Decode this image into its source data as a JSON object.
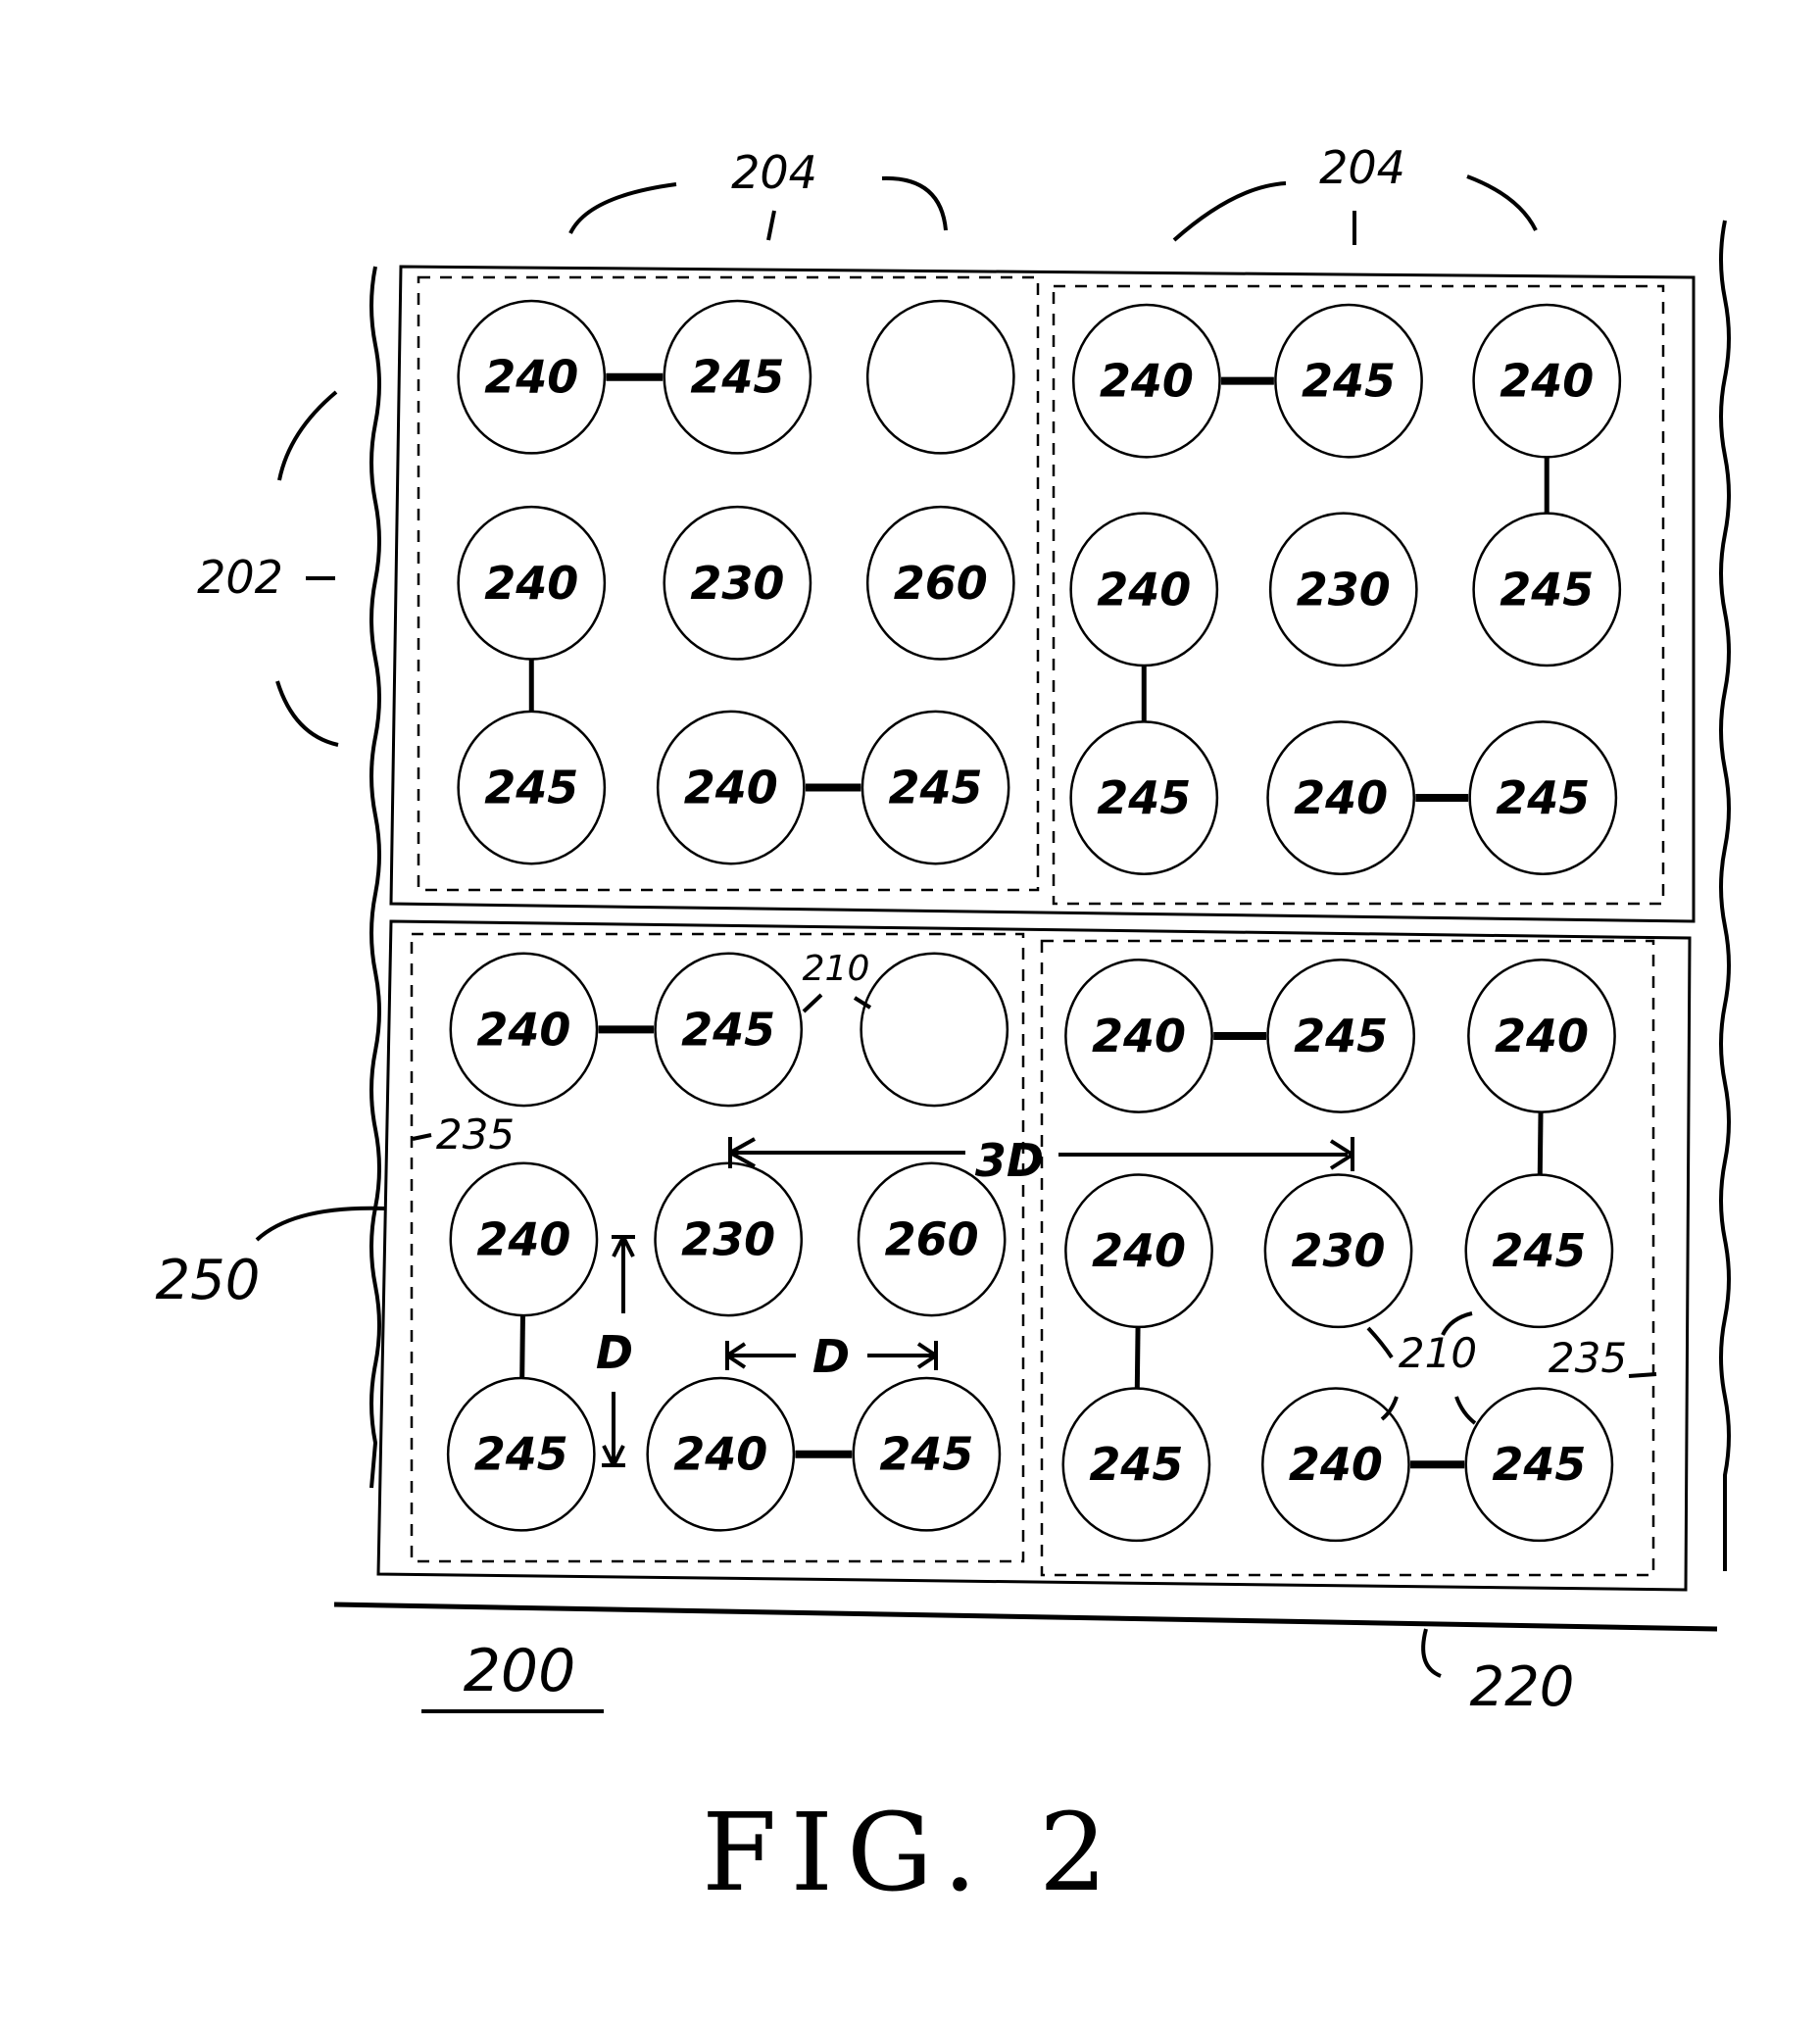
{
  "figure": {
    "title": "FIG. 2",
    "reference_numeral": "200",
    "cells": [
      {
        "block": "top-left",
        "grid": [
          [
            "240",
            "245",
            ""
          ],
          [
            "240",
            "230",
            "260"
          ],
          [
            "245",
            "240",
            "245"
          ]
        ],
        "links": [
          [
            [
              0,
              0
            ],
            [
              0,
              1
            ]
          ],
          [
            [
              1,
              0
            ],
            [
              2,
              0
            ]
          ],
          [
            [
              2,
              1
            ],
            [
              2,
              2
            ]
          ]
        ]
      },
      {
        "block": "top-right",
        "grid": [
          [
            "240",
            "245",
            "240"
          ],
          [
            "240",
            "230",
            "245"
          ],
          [
            "245",
            "240",
            "245"
          ]
        ],
        "links": [
          [
            [
              0,
              0
            ],
            [
              0,
              1
            ]
          ],
          [
            [
              0,
              2
            ],
            [
              1,
              2
            ]
          ],
          [
            [
              1,
              0
            ],
            [
              2,
              0
            ]
          ],
          [
            [
              2,
              1
            ],
            [
              2,
              2
            ]
          ]
        ]
      },
      {
        "block": "bottom-left",
        "grid": [
          [
            "240",
            "245",
            ""
          ],
          [
            "240",
            "230",
            "260"
          ],
          [
            "245",
            "240",
            "245"
          ]
        ],
        "links": [
          [
            [
              0,
              0
            ],
            [
              0,
              1
            ]
          ],
          [
            [
              1,
              0
            ],
            [
              2,
              0
            ]
          ],
          [
            [
              2,
              1
            ],
            [
              2,
              2
            ]
          ]
        ]
      },
      {
        "block": "bottom-right",
        "grid": [
          [
            "240",
            "245",
            "240"
          ],
          [
            "240",
            "230",
            "245"
          ],
          [
            "245",
            "240",
            "245"
          ]
        ],
        "links": [
          [
            [
              0,
              0
            ],
            [
              0,
              1
            ]
          ],
          [
            [
              0,
              2
            ],
            [
              1,
              2
            ]
          ],
          [
            [
              1,
              0
            ],
            [
              2,
              0
            ]
          ],
          [
            [
              2,
              1
            ],
            [
              2,
              2
            ]
          ]
        ]
      }
    ],
    "callouts": {
      "module_left": "204",
      "module_right": "204",
      "row_group": "202",
      "substrate_edge": "250",
      "frame": "220",
      "gap_top": "210",
      "gap_bottom": "210",
      "boundary_left": "235",
      "boundary_right": "235"
    },
    "dimensions": {
      "pitch_horizontal": "D",
      "pitch_vertical": "D",
      "block_span": "3D"
    }
  }
}
